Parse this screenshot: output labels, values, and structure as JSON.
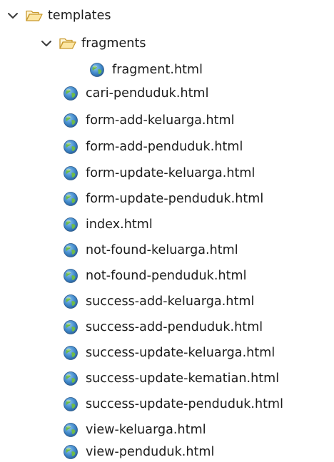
{
  "tree": {
    "root": {
      "label": "templates",
      "expanded_icon": "chevron-down-icon",
      "icon": "open-folder-icon",
      "children": {
        "folder": {
          "label": "fragments",
          "expanded_icon": "chevron-down-icon",
          "icon": "open-folder-icon",
          "files": [
            {
              "label": "fragment.html",
              "icon": "globe-icon"
            }
          ]
        },
        "files": [
          {
            "label": "cari-penduduk.html",
            "icon": "globe-icon"
          },
          {
            "label": "form-add-keluarga.html",
            "icon": "globe-icon"
          },
          {
            "label": "form-add-penduduk.html",
            "icon": "globe-icon"
          },
          {
            "label": "form-update-keluarga.html",
            "icon": "globe-icon"
          },
          {
            "label": "form-update-penduduk.html",
            "icon": "globe-icon"
          },
          {
            "label": "index.html",
            "icon": "globe-icon"
          },
          {
            "label": "not-found-keluarga.html",
            "icon": "globe-icon"
          },
          {
            "label": "not-found-penduduk.html",
            "icon": "globe-icon"
          },
          {
            "label": "success-add-keluarga.html",
            "icon": "globe-icon"
          },
          {
            "label": "success-add-penduduk.html",
            "icon": "globe-icon"
          },
          {
            "label": "success-update-keluarga.html",
            "icon": "globe-icon"
          },
          {
            "label": "success-update-kematian.html",
            "icon": "globe-icon"
          },
          {
            "label": "success-update-penduduk.html",
            "icon": "globe-icon"
          },
          {
            "label": "view-keluarga.html",
            "icon": "globe-icon"
          },
          {
            "label": "view-penduduk.html",
            "icon": "globe-icon"
          }
        ]
      }
    }
  },
  "colors": {
    "text": "#1b1b1b",
    "chevron": "#3a3a3a",
    "folder_fill": "#fce6a3",
    "folder_stroke": "#c99a2e",
    "globe_ocean": "#3f87c9",
    "globe_land": "#6dbb4a"
  }
}
